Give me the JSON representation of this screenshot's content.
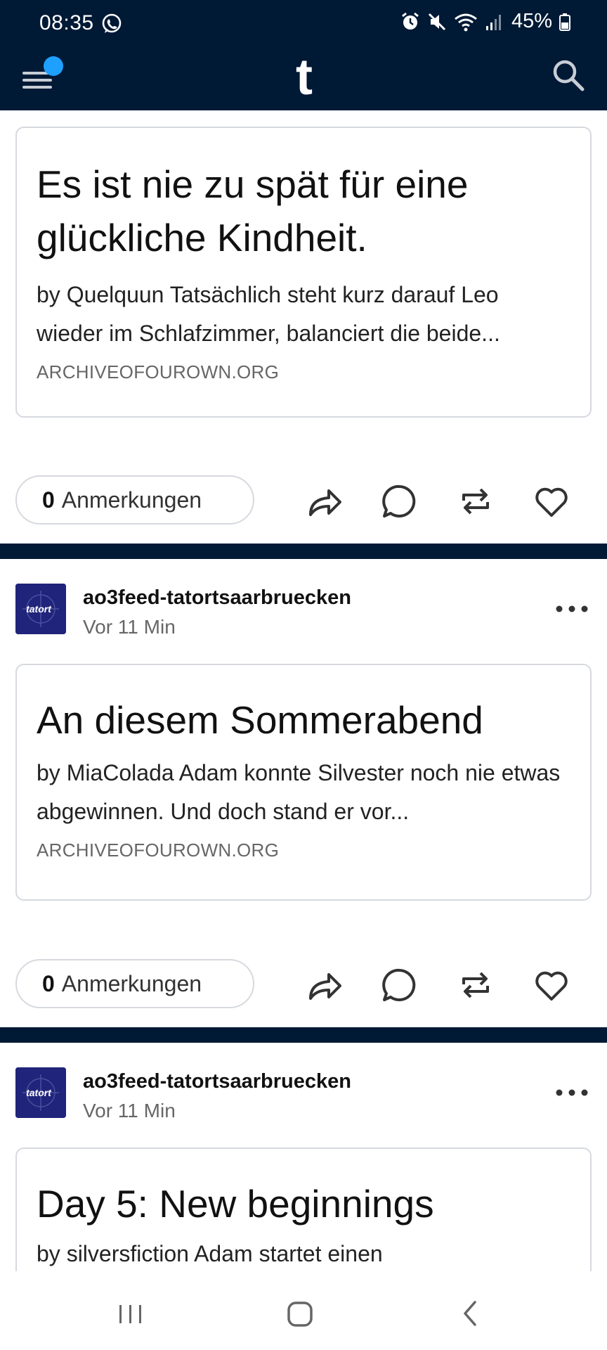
{
  "status_bar": {
    "time": "08:35",
    "battery": "45%"
  },
  "app_bar": {
    "logo_letter": "t"
  },
  "posts": [
    {
      "card": {
        "title": "Es ist nie zu spät für eine glückliche Kindheit.",
        "excerpt": "by Quelquun Tatsächlich steht kurz darauf Leo wieder im Schlafzimmer, balanciert die beide...",
        "source": "ARCHIVEOFOUROWN.ORG"
      },
      "notes": {
        "count": "0",
        "label": "Anmerkungen"
      }
    },
    {
      "blog": "ao3feed-tatortsaarbruecken",
      "time": "Vor 11 Min",
      "avatar_text": "tatort",
      "card": {
        "title": "An diesem Sommerabend",
        "excerpt": "by MiaColada Adam konnte Silvester noch nie etwas abgewinnen. Und doch stand er vor...",
        "source": "ARCHIVEOFOUROWN.ORG"
      },
      "notes": {
        "count": "0",
        "label": "Anmerkungen"
      }
    },
    {
      "blog": "ao3feed-tatortsaarbruecken",
      "time": "Vor 11 Min",
      "avatar_text": "tatort",
      "card": {
        "title": "Day 5: New beginnings",
        "excerpt": "by silversfiction Adam startet einen"
      }
    }
  ],
  "colors": {
    "header_bg": "#001935",
    "accent_dot": "#1ea0ff",
    "avatar_bg": "#20247a"
  }
}
